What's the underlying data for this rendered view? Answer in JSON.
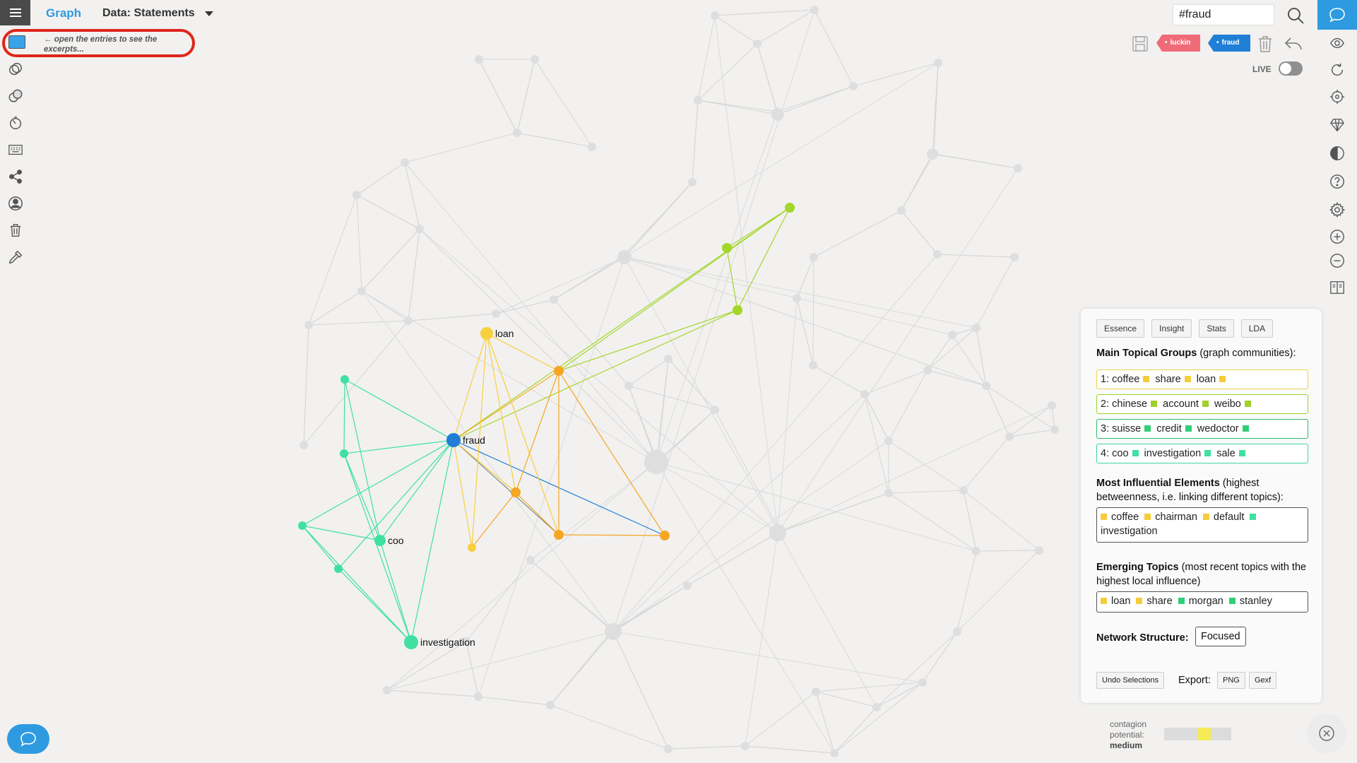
{
  "header": {
    "app_title": "Graph",
    "data_title": "Data: Statements"
  },
  "hint": {
    "text": "← open the entries to see the excerpts..."
  },
  "search": {
    "value": "#fraud"
  },
  "tags": [
    {
      "label": "luckin",
      "color": "#f06b78"
    },
    {
      "label": "fraud",
      "color": "#1f7fd6"
    }
  ],
  "live": {
    "label": "LIVE",
    "on": false
  },
  "left_toolbar": [
    {
      "name": "entries-icon"
    },
    {
      "name": "filter-overlap-icon"
    },
    {
      "name": "compare-overlap-icon"
    },
    {
      "name": "timer-icon"
    },
    {
      "name": "keyboard-icon"
    },
    {
      "name": "share-icon"
    },
    {
      "name": "user-icon"
    },
    {
      "name": "trash-icon"
    },
    {
      "name": "pipette-icon"
    }
  ],
  "right_toolbar": [
    {
      "name": "eye-icon"
    },
    {
      "name": "refresh-icon"
    },
    {
      "name": "target-icon"
    },
    {
      "name": "diamond-icon"
    },
    {
      "name": "contrast-icon"
    },
    {
      "name": "help-icon"
    },
    {
      "name": "settings-icon"
    },
    {
      "name": "zoom-in-icon"
    },
    {
      "name": "zoom-out-icon"
    },
    {
      "name": "book-icon"
    }
  ],
  "panel": {
    "tabs": [
      "Essence",
      "Insight",
      "Stats",
      "LDA"
    ],
    "groups_title_bold": "Main Topical Groups",
    "groups_title_rest": " (graph communities):",
    "groups": [
      {
        "prefix": "1:",
        "words": [
          "coffee",
          "share",
          "loan"
        ],
        "color": "#f5cc3a",
        "border": "#e9d34a"
      },
      {
        "prefix": "2:",
        "words": [
          "chinese",
          "account",
          "weibo"
        ],
        "color": "#9fd12c",
        "border": "#9fd12c"
      },
      {
        "prefix": "3:",
        "words": [
          "suisse",
          "credit",
          "wedoctor"
        ],
        "color": "#2fcf77",
        "border": "#2fb872"
      },
      {
        "prefix": "4:",
        "words": [
          "coo",
          "investigation",
          "sale"
        ],
        "color": "#3fe0a2",
        "border": "#3fd6a0"
      }
    ],
    "influential_title_bold": "Most Influential Elements",
    "influential_title_rest": " (highest betweenness, i.e. linking different topics):",
    "influential": [
      {
        "word": "coffee",
        "color": "#f5cc3a"
      },
      {
        "word": "chairman",
        "color": "#f5cc3a"
      },
      {
        "word": "default",
        "color": "#f5cc3a"
      },
      {
        "word": "investigation",
        "color": "#3fe0a2"
      }
    ],
    "emerging_title_bold": "Emerging Topics",
    "emerging_title_rest": " (most recent topics with the highest local influence)",
    "emerging": [
      {
        "word": "loan",
        "color": "#f5cc3a"
      },
      {
        "word": "share",
        "color": "#f5cc3a"
      },
      {
        "word": "morgan",
        "color": "#2fcf77"
      },
      {
        "word": "stanley",
        "color": "#2fcf77"
      }
    ],
    "network_structure_label": "Network Structure:",
    "network_structure_value": "Focused",
    "undo_label": "Undo Selections",
    "export_label": "Export:",
    "png_label": "PNG",
    "gexf_label": "Gexf"
  },
  "contagion": {
    "label1": "contagion",
    "label2": "potential:",
    "value": "medium",
    "level_fraction": 0.5
  },
  "graph": {
    "labeled_nodes": [
      {
        "id": "loan",
        "label": "loan",
        "color": "#f8cf3c"
      },
      {
        "id": "fraud",
        "label": "fraud",
        "color": "#1f7fd6"
      },
      {
        "id": "coo",
        "label": "coo",
        "color": "#3fe0a2"
      },
      {
        "id": "investigation",
        "label": "investigation",
        "color": "#3fe0a2"
      }
    ],
    "colors": {
      "yellow": "#f8cf3c",
      "orange": "#f5a623",
      "lime": "#a3d62a",
      "teal": "#3fe0a2",
      "blue": "#1f7fd6",
      "grey": "#dcdcdc"
    }
  }
}
